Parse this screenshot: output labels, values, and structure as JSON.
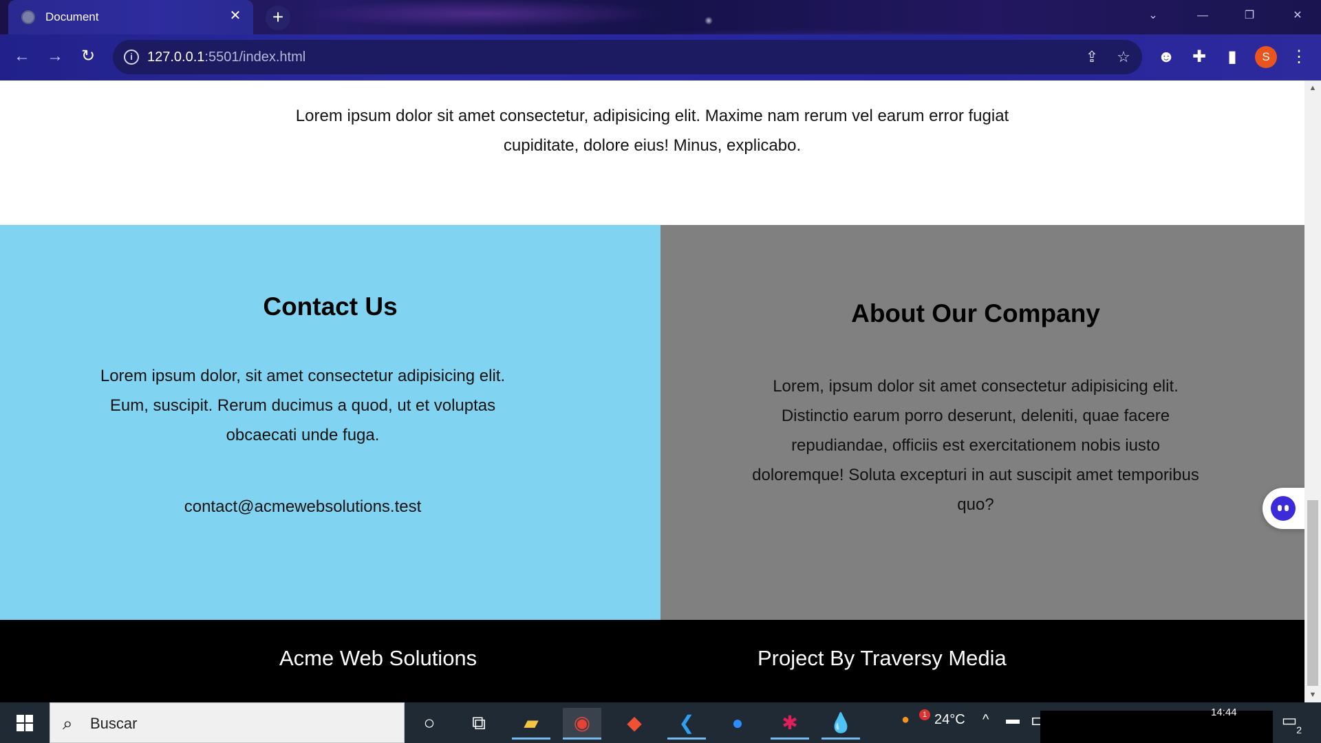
{
  "browser": {
    "tab_title": "Document",
    "tab_close": "✕",
    "new_tab": "+",
    "url_host": "127.0.0.1",
    "url_rest": ":5501/index.html",
    "profile_initial": "S"
  },
  "page": {
    "intro_text": "Lorem ipsum dolor sit amet consectetur, adipisicing elit. Maxime nam rerum vel earum error fugiat cupiditate, dolore eius! Minus, explicabo.",
    "contact": {
      "heading": "Contact Us",
      "text": "Lorem ipsum dolor, sit amet consectetur adipisicing elit. Eum, suscipit. Rerum ducimus a quod, ut et voluptas obcaecati unde fuga.",
      "email": "contact@acmewebsolutions.test",
      "background": "#81d4f1"
    },
    "about": {
      "heading": "About Our Company",
      "text": "Lorem, ipsum dolor sit amet consectetur adipisicing elit. Distinctio earum porro deserunt, deleniti, quae facere repudiandae, officiis est exercitationem nobis iusto doloremque! Soluta excepturi in aut suscipit amet temporibus quo?",
      "background": "#808080"
    },
    "footer": {
      "left": "Acme Web Solutions",
      "right": "Project By Traversy Media"
    }
  },
  "taskbar": {
    "search_placeholder": "Buscar",
    "weather": "24°C",
    "weather_badge": "1",
    "clock": "14:44",
    "notifications_count": "2",
    "apps": [
      "cortana-icon",
      "task-view-icon",
      "file-explorer-icon",
      "chrome-icon",
      "git-icon",
      "vscode-icon",
      "zoom-icon",
      "slack-icon",
      "paint-icon"
    ]
  }
}
